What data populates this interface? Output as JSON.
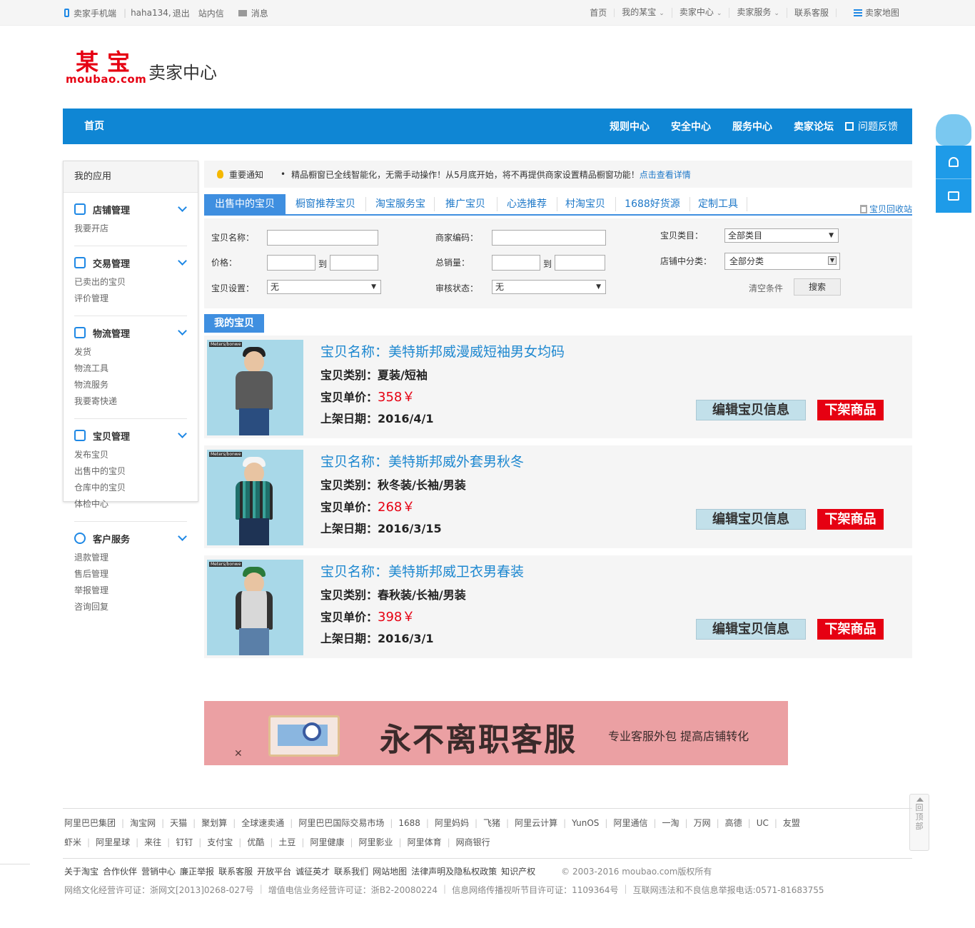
{
  "topbar": {
    "mobile": "卖家手机端",
    "user": "haha134,",
    "logout": "退出",
    "inbox": "站内信",
    "messages": "消息",
    "right": [
      "首页",
      "我的某宝",
      "卖家中心",
      "卖家服务",
      "联系客服"
    ],
    "sitemap": "卖家地图"
  },
  "logo": {
    "cn": "某宝",
    "en": "moubao.com",
    "title": "卖家中心"
  },
  "nav": {
    "home": "首页",
    "links": [
      "规则中心",
      "安全中心",
      "服务中心",
      "卖家论坛"
    ],
    "feedback": "问题反馈"
  },
  "sidebar": {
    "title": "我的应用",
    "groups": [
      {
        "title": "店铺管理",
        "icon": "store-icon",
        "links": [
          "我要开店"
        ]
      },
      {
        "title": "交易管理",
        "icon": "trade-icon",
        "links": [
          "已卖出的宝贝",
          "评价管理"
        ]
      },
      {
        "title": "物流管理",
        "icon": "truck-icon",
        "links": [
          "发货",
          "物流工具",
          "物流服务",
          "我要寄快递"
        ]
      },
      {
        "title": "宝贝管理",
        "icon": "shirt-icon",
        "links": [
          "发布宝贝",
          "出售中的宝贝",
          "仓库中的宝贝",
          "体检中心"
        ]
      },
      {
        "title": "客户服务",
        "icon": "user-icon",
        "links": [
          "退款管理",
          "售后管理",
          "举报管理",
          "咨询回复"
        ]
      }
    ]
  },
  "notice": {
    "label": "重要通知",
    "text": "精品橱窗已全线智能化，无需手动操作！从5月底开始，将不再提供商家设置精品橱窗功能！",
    "link": "点击查看详情"
  },
  "tabs": [
    "出售中的宝贝",
    "橱窗推荐宝贝",
    "淘宝服务宝",
    "推广宝贝",
    "心选推荐",
    "村淘宝贝",
    "1688好货源",
    "定制工具"
  ],
  "recycle": "宝贝回收站",
  "filter": {
    "name_label": "宝贝名称：",
    "code_label": "商家编码：",
    "category_label": "宝贝类目：",
    "category_value": "全部类目",
    "price_label": "价格：",
    "to": "到",
    "sales_label": "总销量：",
    "shop_cat_label": "店铺中分类：",
    "shop_cat_value": "全部分类",
    "setting_label": "宝贝设置：",
    "setting_value": "无",
    "audit_label": "审核状态：",
    "audit_value": "无",
    "clear": "清空条件",
    "search": "搜索"
  },
  "my_items_title": "我的宝贝",
  "items": [
    {
      "name": "宝贝名称：美特斯邦威漫威短袖男女均码",
      "category": "宝贝类别：夏装/短袖",
      "price_label": "宝贝单价：",
      "price": "358￥",
      "date": "上架日期：2016/4/1",
      "brand": "Meters/bonwe"
    },
    {
      "name": "宝贝名称：美特斯邦威外套男秋冬",
      "category": "宝贝类别：秋冬装/长袖/男装",
      "price_label": "宝贝单价：",
      "price": "268￥",
      "date": "上架日期：2016/3/15",
      "brand": "Meters/bonwe"
    },
    {
      "name": "宝贝名称：美特斯邦威卫衣男春装",
      "category": "宝贝类别：春秋装/长袖/男装",
      "price_label": "宝贝单价：",
      "price": "398￥",
      "date": "上架日期：2016/3/1",
      "brand": "Meters/bonwe"
    }
  ],
  "item_buttons": {
    "edit": "编辑宝贝信息",
    "off": "下架商品"
  },
  "banner": {
    "main": "永不离职客服",
    "sub": "专业客服外包 提高店铺转化"
  },
  "backtop": "回顶部",
  "footer": {
    "row1": [
      "阿里巴巴集团",
      "淘宝网",
      "天猫",
      "聚划算",
      "全球速卖通",
      "阿里巴巴国际交易市场",
      "1688",
      "阿里妈妈",
      "飞猪",
      "阿里云计算",
      "YunOS",
      "阿里通信",
      "一淘",
      "万网",
      "高德",
      "UC",
      "友盟"
    ],
    "row2": [
      "虾米",
      "阿里星球",
      "来往",
      "钉钉",
      "支付宝",
      "优酷",
      "土豆",
      "阿里健康",
      "阿里影业",
      "阿里体育",
      "网商银行"
    ],
    "row3": [
      "关于淘宝",
      "合作伙伴",
      "营销中心",
      "廉正举报",
      "联系客服",
      "开放平台",
      "诚征英才",
      "联系我们",
      "网站地图",
      "法律声明及隐私权政策",
      "知识产权"
    ],
    "copyright": "© 2003-2016  moubao.com版权所有",
    "row4": [
      "网络文化经营许可证：浙网文[2013]0268-027号",
      "增值电信业务经营许可证：浙B2-20080224",
      "信息网络传播视听节目许可证：1109364号",
      "互联网违法和不良信息举报电话:0571-81683755"
    ]
  },
  "colors": {
    "primary": "#0f86d4",
    "tab": "#3f8fe0",
    "price": "#e60012",
    "link": "#1e78c8"
  }
}
